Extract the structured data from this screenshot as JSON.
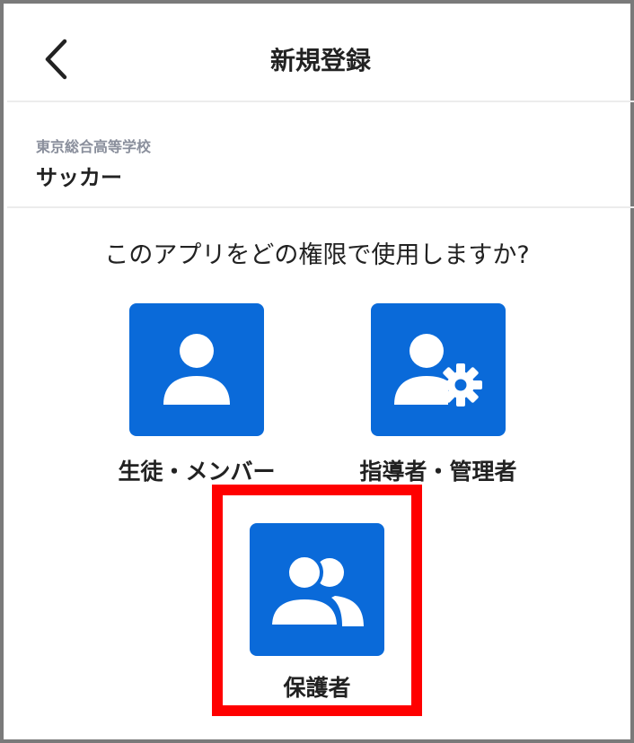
{
  "header": {
    "title": "新規登録",
    "back_icon": "chevron-left-icon"
  },
  "team": {
    "school": "東京総合高等学校",
    "name": "サッカー"
  },
  "question": "このアプリをどの権限で使用しますか?",
  "roles": [
    {
      "label": "生徒・メンバー",
      "icon": "person-icon"
    },
    {
      "label": "指導者・管理者",
      "icon": "person-gear-icon"
    },
    {
      "label": "保護者",
      "icon": "people-icon"
    }
  ],
  "highlight": {
    "target": "parent",
    "color": "#ff0000"
  },
  "colors": {
    "accent": "#0a6ad9",
    "text": "#222222",
    "subtext": "#8a8f9c"
  }
}
